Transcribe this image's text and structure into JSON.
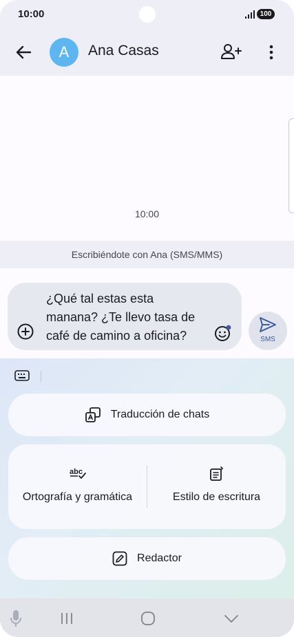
{
  "status_bar": {
    "time": "10:00",
    "battery": "100",
    "signal_icon": "signal-icon"
  },
  "app_bar": {
    "avatar_letter": "A",
    "contact_name": "Ana Casas",
    "back_icon": "arrow-left-icon",
    "add_person_icon": "person-add-icon",
    "more_icon": "more-vert-icon"
  },
  "conversation": {
    "time": "10:00"
  },
  "protocol_banner": {
    "text": "Escribiéndote con Ana (SMS/MMS)"
  },
  "compose": {
    "message_lines": [
      "¿Qué tal estas esta",
      "manana? ¿Te llevo tasa de",
      "café de camino a oficina?"
    ],
    "send_label": "SMS"
  },
  "ai_panel": {
    "translate_label": "Traducción de chats",
    "spelling_label": "Ortografía y gramática",
    "style_label": "Estilo de escritura",
    "compose_label": "Redactor"
  },
  "colors": {
    "accent": "#3c5a9c",
    "avatar": "#5db6f0",
    "header": "#edeef6"
  }
}
